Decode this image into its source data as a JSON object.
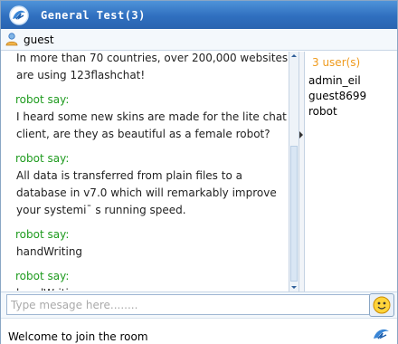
{
  "window": {
    "title": "General Test(3)"
  },
  "current_user": {
    "name": "guest"
  },
  "messages": [
    {
      "text": "In more than 70 countries, over 200,000 websites are using 123flashchat!"
    },
    {
      "sender": "robot say:",
      "text": "I heard some new skins are made for the lite chat client, are they as beautiful as a female robot?"
    },
    {
      "sender": "robot say:",
      "text": "All data is transferred from plain files to a database in v7.0 which will remarkably improve your systemi¯ s running speed."
    },
    {
      "sender": "robot say:",
      "text": "handWriting"
    },
    {
      "sender": "robot say:",
      "text": "handWriting"
    }
  ],
  "users_panel": {
    "count_label": "3 user(s)",
    "users": [
      "admin_eil",
      "guest8699",
      "robot"
    ]
  },
  "input": {
    "placeholder": "Type mesage here........"
  },
  "status": {
    "text": "Welcome to join the room"
  },
  "icons": {
    "app_logo": "123flashchat-logo-icon",
    "user": "user-icon",
    "emoji": "emoji-smiley-icon",
    "collapse": "collapse-arrow-icon"
  },
  "colors": {
    "title_bar": "#2f6fbf",
    "sender": "#1f9b1f",
    "user_count": "#ef9a1c"
  }
}
